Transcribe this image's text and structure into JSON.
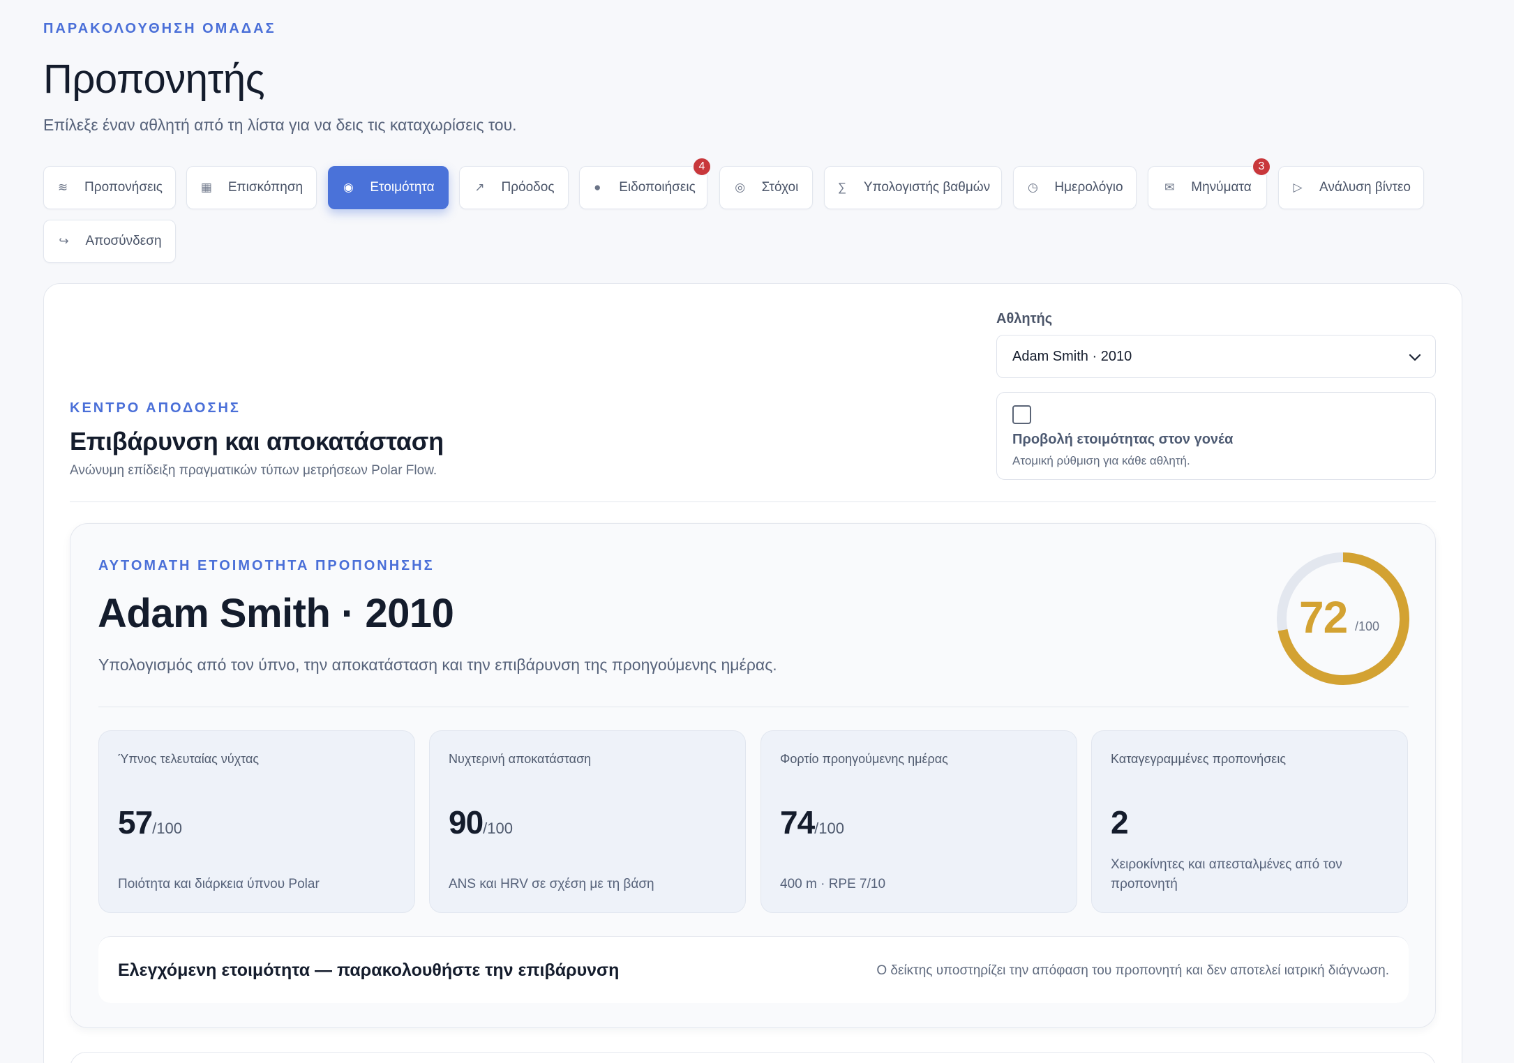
{
  "header": {
    "eyebrow": "ΠΑΡΑΚΟΛΟΥΘΗΣΗ ΟΜΑΔΑΣ",
    "title": "Προπονητής",
    "subtitle": "Επίλεξε έναν αθλητή από τη λίστα για να δεις τις καταχωρίσεις του."
  },
  "tabs": [
    {
      "label": "Προπονήσεις",
      "icon": "waves-icon",
      "glyph": "≋"
    },
    {
      "label": "Επισκόπηση",
      "icon": "grid-icon",
      "glyph": "▦"
    },
    {
      "label": "Ετοιμότητα",
      "icon": "target-icon",
      "glyph": "◉",
      "active": true
    },
    {
      "label": "Πρόοδος",
      "icon": "trend-arrow-icon",
      "glyph": "↗"
    },
    {
      "label": "Ειδοποιήσεις",
      "icon": "dot-icon",
      "glyph": "●",
      "badge": "4"
    },
    {
      "label": "Στόχοι",
      "icon": "bullseye-icon",
      "glyph": "◎"
    },
    {
      "label": "Υπολογιστής βαθμών",
      "icon": "sigma-icon",
      "glyph": "∑"
    },
    {
      "label": "Ημερολόγιο",
      "icon": "clock-icon",
      "glyph": "◷"
    },
    {
      "label": "Μηνύματα",
      "icon": "envelope-icon",
      "glyph": "✉",
      "badge": "3"
    },
    {
      "label": "Ανάλυση βίντεο",
      "icon": "play-icon",
      "glyph": "▷"
    },
    {
      "label": "Αποσύνδεση",
      "icon": "logout-icon",
      "glyph": "↪"
    }
  ],
  "athlete_picker": {
    "label": "Αθλητής",
    "selected": "Adam Smith · 2010",
    "parent_view_title": "Προβολή ετοιμότητας στον γονέα",
    "parent_view_sub": "Ατομική ρύθμιση για κάθε αθλητή.",
    "parent_view_checked": false
  },
  "section": {
    "eyebrow": "ΚΕΝΤΡΟ ΑΠΟΔΟΣΗΣ",
    "title": "Επιβάρυνση και αποκατάσταση",
    "subtitle": "Ανώνυμη επίδειξη πραγματικών τύπων μετρήσεων Polar Flow."
  },
  "readiness": {
    "eyebrow": "ΑΥΤΟΜΑΤΗ ΕΤΟΙΜΟΤΗΤΑ ΠΡΟΠΟΝΗΣΗΣ",
    "athlete": "Adam Smith · 2010",
    "description": "Υπολογισμός από τον ύπνο, την αποκατάσταση και την επιβάρυνση της προηγούμενης ημέρας.",
    "score": "72",
    "score_max": "/100",
    "score_fraction": 0.72,
    "ring_color": "#d3a232",
    "ring_track_color": "#e3e7ef",
    "metrics": [
      {
        "label": "Ύπνος τελευταίας νύχτας",
        "value": "57",
        "unit": "/100",
        "note": "Ποιότητα και διάρκεια ύπνου Polar"
      },
      {
        "label": "Νυχτερινή αποκατάσταση",
        "value": "90",
        "unit": "/100",
        "note": "ANS και HRV σε σχέση με τη βάση"
      },
      {
        "label": "Φορτίο προηγούμενης ημέρας",
        "value": "74",
        "unit": "/100",
        "note": "400 m · RPE 7/10"
      },
      {
        "label": "Καταγεγραμμένες προπονήσεις",
        "value": "2",
        "unit": "",
        "note": "Χειροκίνητες και απεσταλμένες από τον προπονητή"
      }
    ],
    "verdict_title": "Ελεγχόμενη ετοιμότητα — παρακολουθήστε την επιβάρυνση",
    "verdict_note": "Ο δείκτης υποστηρίζει την απόφαση του προπονητή και δεν αποτελεί ιατρική διάγνωση."
  }
}
